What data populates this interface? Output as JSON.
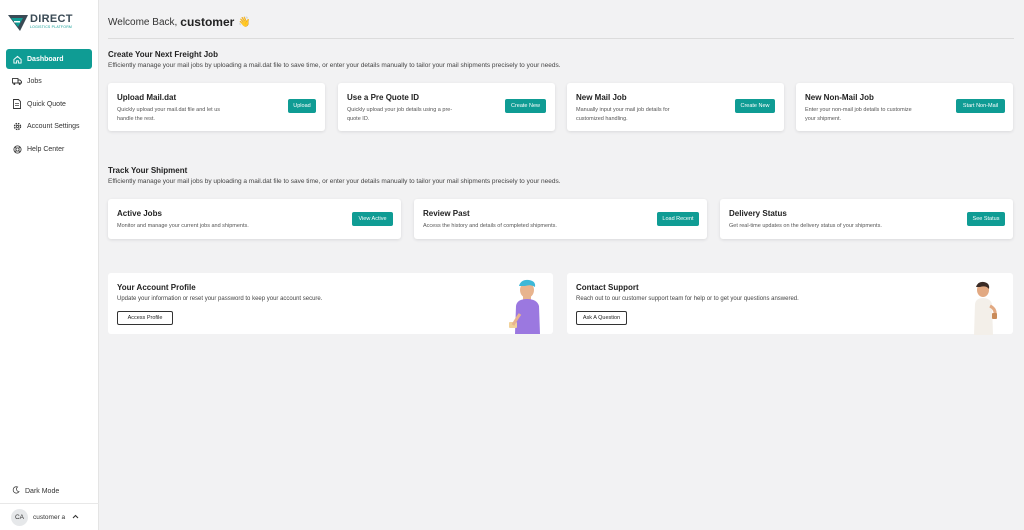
{
  "brand": {
    "name": "DIRECT",
    "tagline": "LOGISTICS PLATFORM",
    "color": "#0f9c94"
  },
  "sidebar": {
    "items": [
      {
        "label": "Dashboard",
        "icon": "home-icon",
        "active": true
      },
      {
        "label": "Jobs",
        "icon": "truck-icon"
      },
      {
        "label": "Quick Quote",
        "icon": "document-icon"
      },
      {
        "label": "Account Settings",
        "icon": "gear-icon"
      },
      {
        "label": "Help Center",
        "icon": "lifebuoy-icon"
      }
    ],
    "dark_mode": "Dark Mode",
    "user": {
      "initials": "CA",
      "name": "customer a"
    }
  },
  "header": {
    "welcome": "Welcome Back,",
    "username": "customer"
  },
  "create_section": {
    "title": "Create Your Next Freight Job",
    "description": "Efficiently manage your mail jobs by uploading a mail.dat file to save time, or enter your details manually to tailor your mail shipments precisely to your needs.",
    "cards": [
      {
        "title": "Upload Mail.dat",
        "desc1": "Quickly upload your mail.dat file and let us",
        "desc2": "handle the rest.",
        "button": "Upload"
      },
      {
        "title": "Use a Pre Quote ID",
        "desc1": "Quickly upload your job details using a pre-",
        "desc2": "quote ID.",
        "button": "Create New"
      },
      {
        "title": "New Mail Job",
        "desc1": "Manually input your mail job details for",
        "desc2": "customized handling.",
        "button": "Create New"
      },
      {
        "title": "New Non-Mail Job",
        "desc1": "Enter your non-mail job details to customize",
        "desc2": "your shipment.",
        "button": "Start Non-Mail"
      }
    ]
  },
  "track_section": {
    "title": "Track Your Shipment",
    "description": "Efficiently manage your mail jobs by uploading a mail.dat file to save time, or enter your details manually to tailor your mail shipments precisely to your needs.",
    "cards": [
      {
        "title": "Active Jobs",
        "desc": "Monitor and manage your current jobs and shipments.",
        "button": "View Active"
      },
      {
        "title": "Review Past",
        "desc": "Access the history and details of completed shipments.",
        "button": "Load Recent"
      },
      {
        "title": "Delivery Status",
        "desc": "Get real-time updates on the delivery status of your shipments.",
        "button": "See Status"
      }
    ]
  },
  "bottom": {
    "profile": {
      "title": "Your Account Profile",
      "desc": "Update your information or reset your password to keep your account secure.",
      "button": "Access Profile"
    },
    "support": {
      "title": "Contact Support",
      "desc": "Reach out to our customer support team for help or to get your questions answered.",
      "button": "Ask A Question"
    }
  }
}
